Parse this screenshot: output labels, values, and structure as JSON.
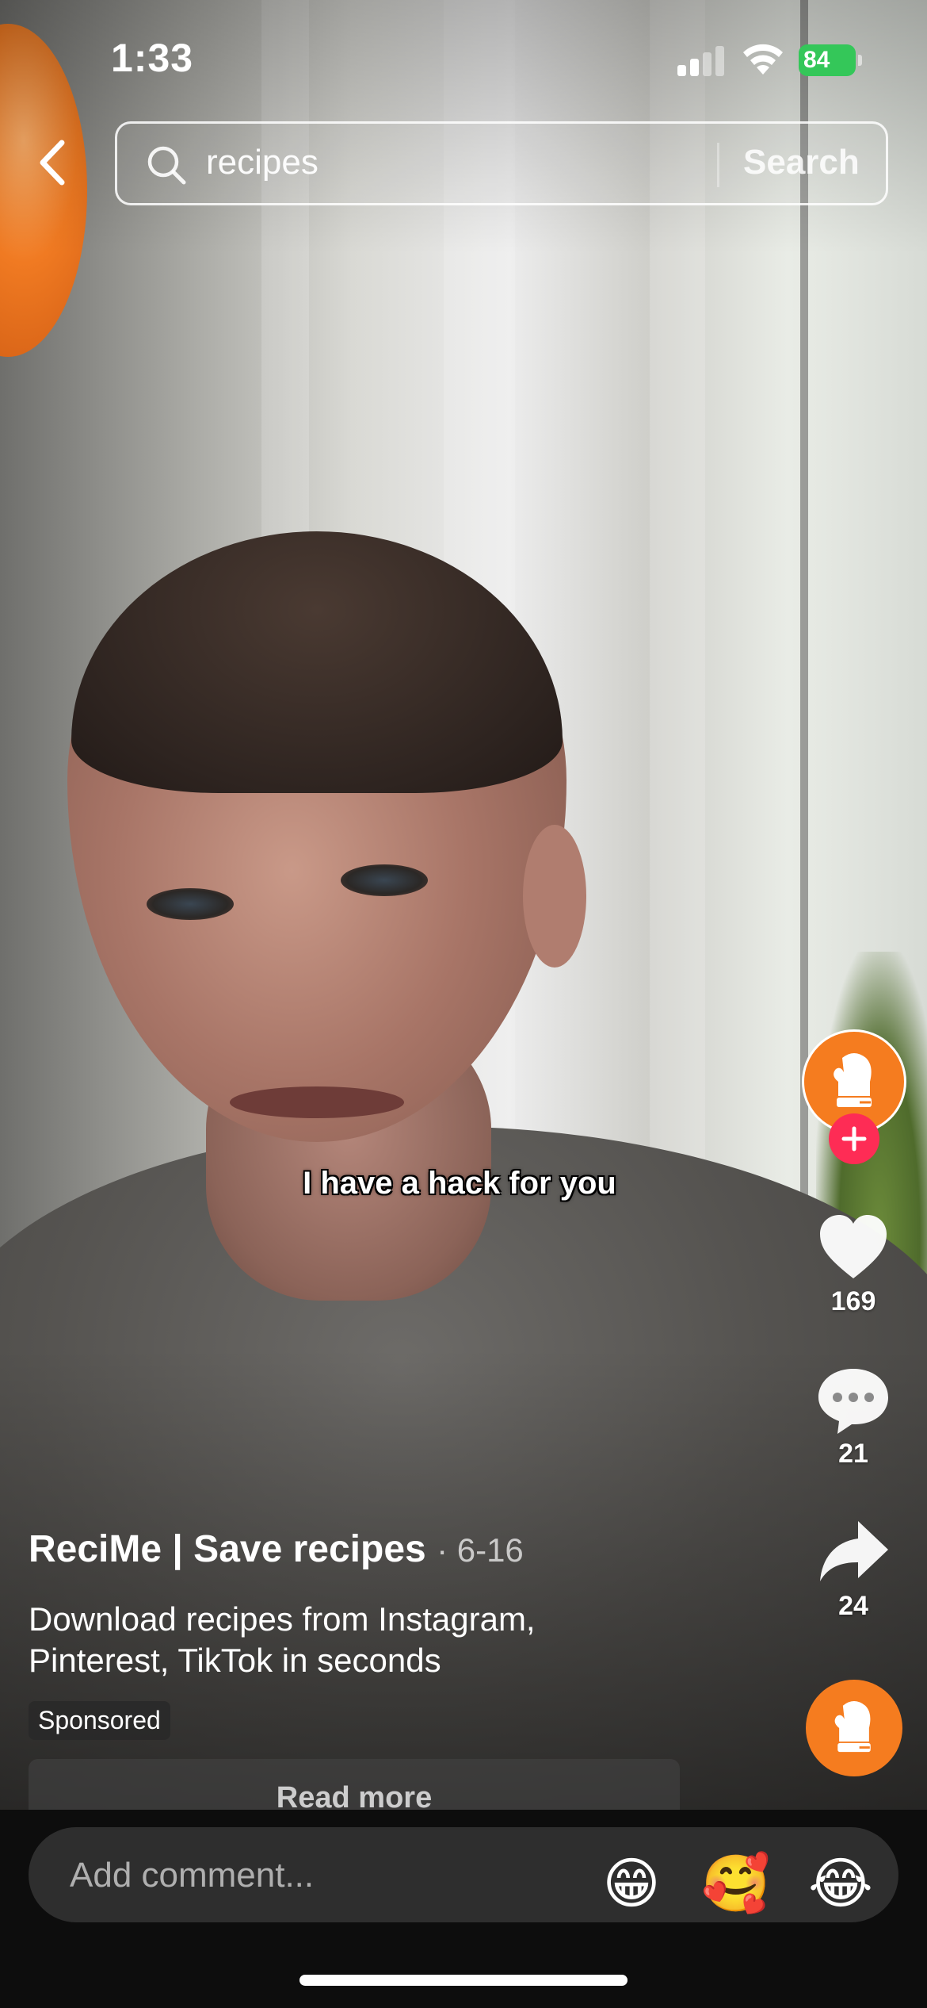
{
  "status_bar": {
    "time": "1:33",
    "battery_level": "84"
  },
  "search": {
    "query": "recipes",
    "submit_label": "Search"
  },
  "video": {
    "caption": "I have a hack for you"
  },
  "actions": {
    "likes": "169",
    "comments": "21",
    "shares": "24"
  },
  "ad": {
    "account": "ReciMe | Save recipes",
    "date": "· 6-16",
    "description": "Download recipes from Instagram, Pinterest, TikTok in seconds",
    "sponsored_label": "Sponsored",
    "read_more_label": "Read more"
  },
  "comment_bar": {
    "placeholder": "Add comment...",
    "emojis": [
      "😁",
      "🥰",
      "😂"
    ]
  },
  "colors": {
    "brand_orange": "#f57c1f",
    "follow_red": "#fe2c55",
    "battery_green": "#34c759"
  }
}
